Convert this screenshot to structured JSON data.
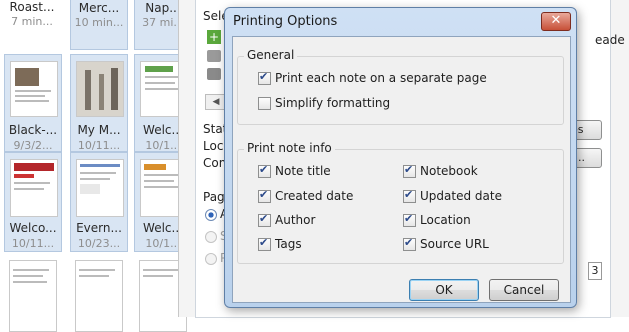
{
  "notes": [
    {
      "title": "Roast...",
      "date": "7 min..."
    },
    {
      "title": "Merc...",
      "date": "10 min..."
    },
    {
      "title": "Nap...",
      "date": "37 mi..."
    },
    {
      "title": "Black-...",
      "date": "9/3/2..."
    },
    {
      "title": "My M...",
      "date": "10/11..."
    },
    {
      "title": "Welc...",
      "date": "10/1..."
    },
    {
      "title": "Welco...",
      "date": "10/11..."
    },
    {
      "title": "Evern...",
      "date": "10/23..."
    },
    {
      "title": "Welc...",
      "date": "10/1..."
    }
  ],
  "background": {
    "select_label": "Selec",
    "reade_label": "eade",
    "status_label": "Statu",
    "location_label": "Loca",
    "comments_label": "Comm",
    "es_button": "es",
    "r_button": "r...",
    "pages_label": "Page",
    "radio_1": "A",
    "radio_2": "S",
    "radio_3": "P",
    "page_num": "3"
  },
  "dialog": {
    "title": "Printing Options",
    "close_glyph": "✕",
    "general": {
      "title": "General",
      "options": [
        {
          "label": "Print each note on a separate page",
          "checked": true
        },
        {
          "label": "Simplify formatting",
          "checked": false
        }
      ]
    },
    "note_info": {
      "title": "Print note info",
      "left": [
        {
          "label": "Note title",
          "checked": true
        },
        {
          "label": "Created date",
          "checked": true
        },
        {
          "label": "Author",
          "checked": true
        },
        {
          "label": "Tags",
          "checked": true
        }
      ],
      "right": [
        {
          "label": "Notebook",
          "checked": true
        },
        {
          "label": "Updated date",
          "checked": true
        },
        {
          "label": "Location",
          "checked": true
        },
        {
          "label": "Source URL",
          "checked": true
        }
      ]
    },
    "ok_label": "OK",
    "cancel_label": "Cancel"
  }
}
